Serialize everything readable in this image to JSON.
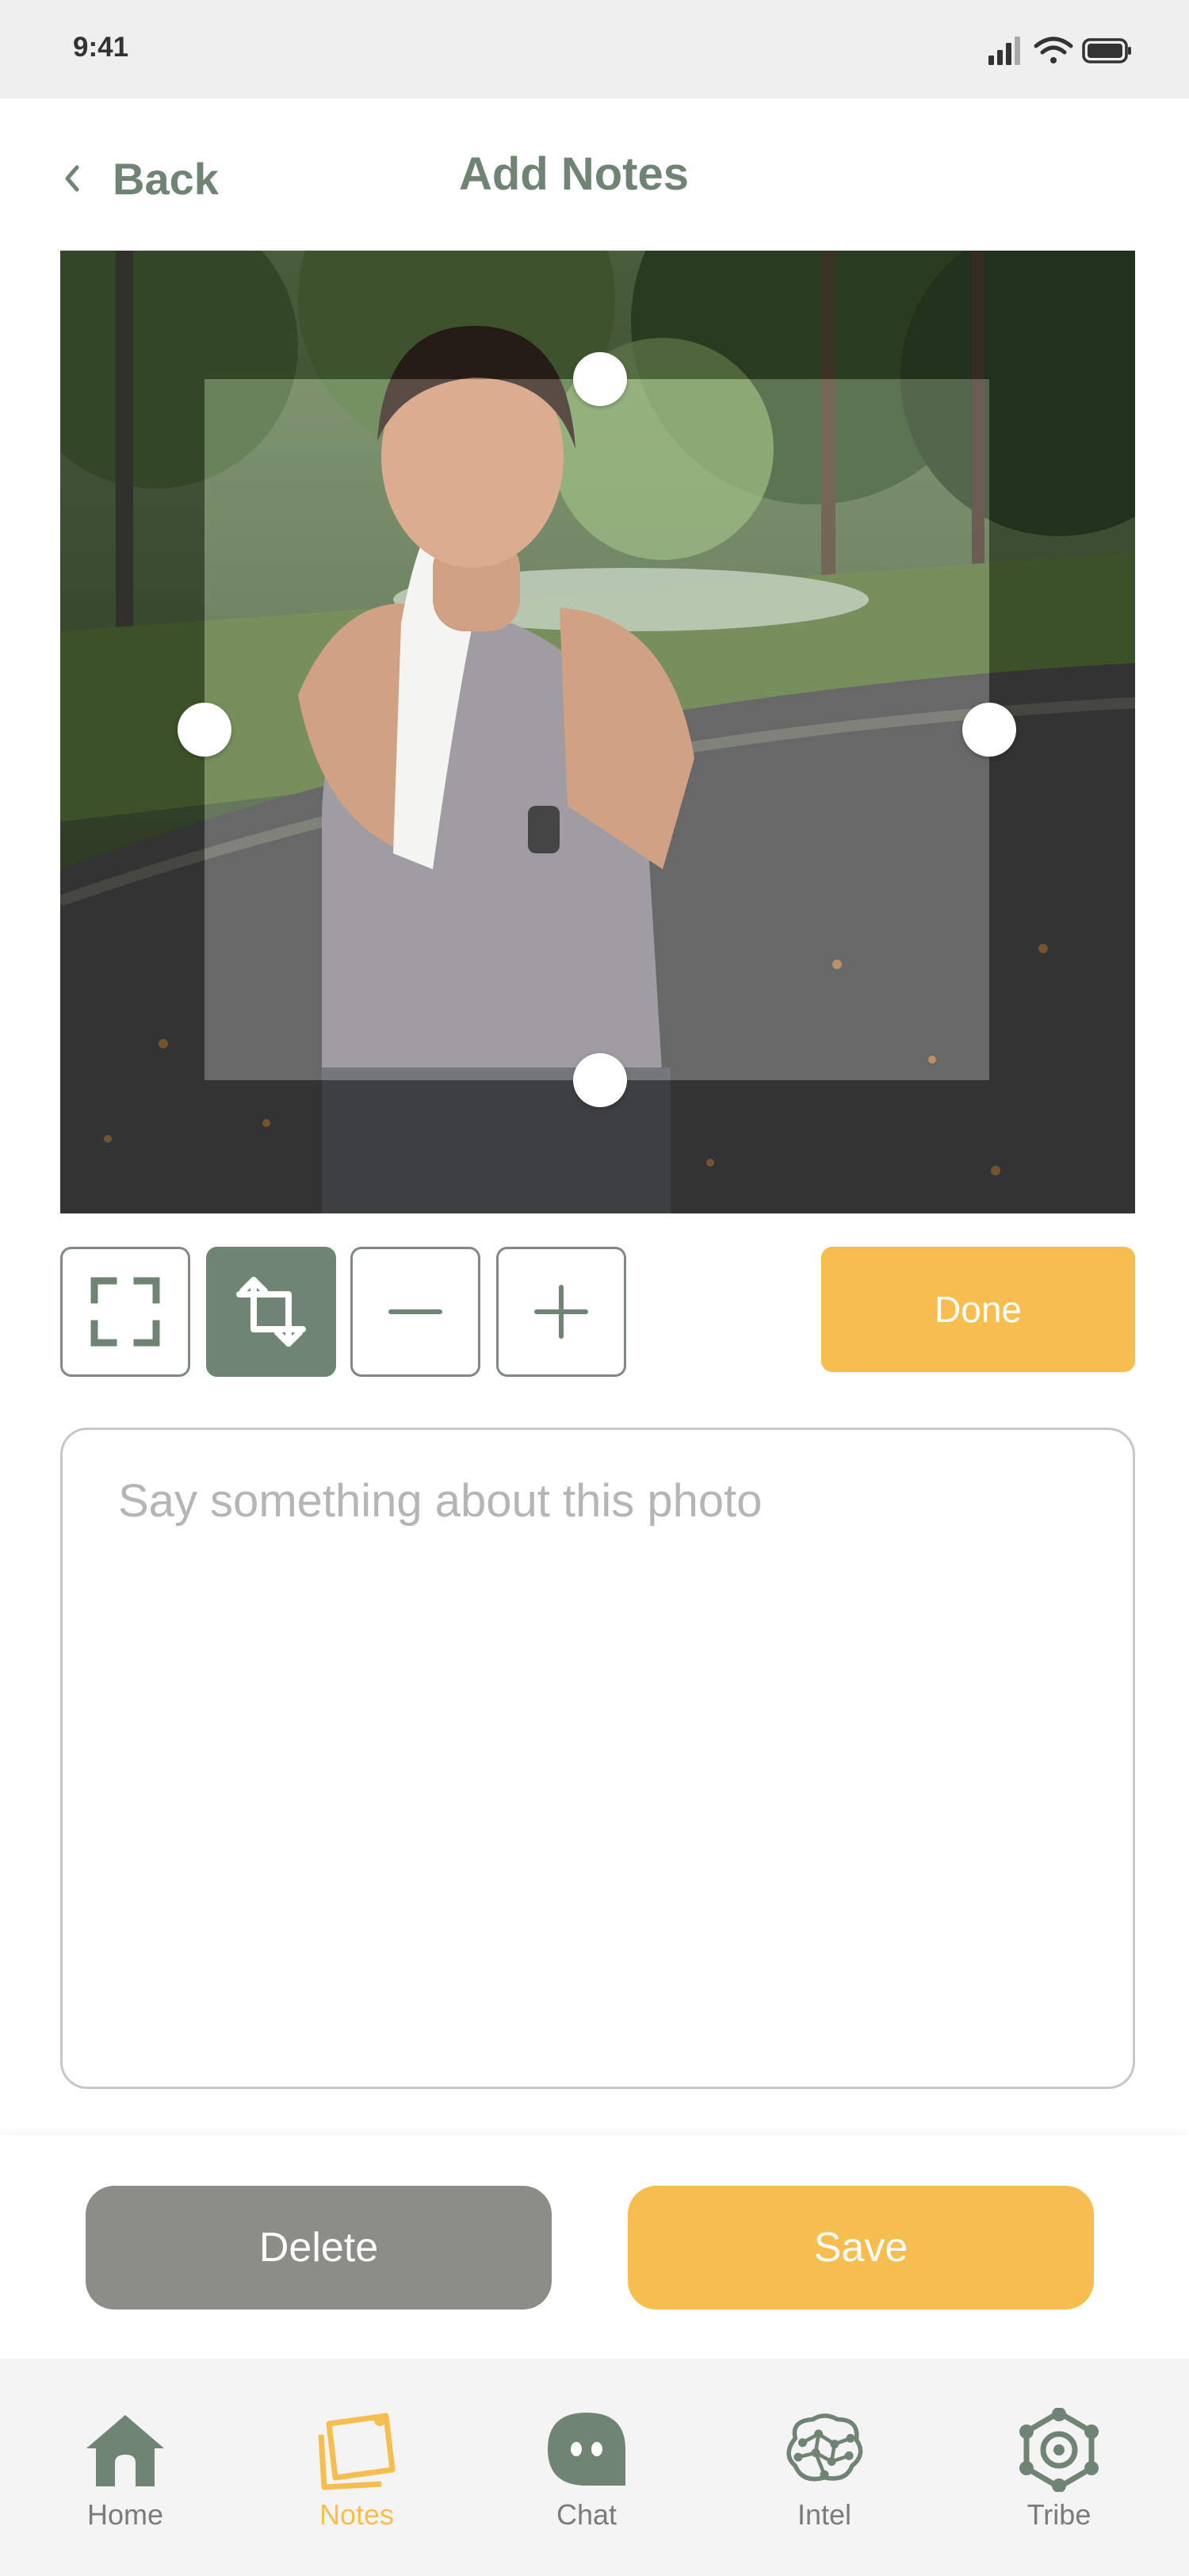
{
  "status_bar": {
    "time": "9:41"
  },
  "header": {
    "back_label": "Back",
    "title": "Add Notes"
  },
  "editor": {
    "tools": [
      {
        "name": "fullscreen",
        "icon": "fullscreen-icon",
        "active": false
      },
      {
        "name": "crop",
        "icon": "crop-icon",
        "active": true
      },
      {
        "name": "zoom-out",
        "icon": "minus-icon",
        "active": false
      },
      {
        "name": "zoom-in",
        "icon": "plus-icon",
        "active": false
      }
    ],
    "done_label": "Done"
  },
  "notes": {
    "placeholder": "Say something about this photo",
    "value": ""
  },
  "actions": {
    "delete_label": "Delete",
    "save_label": "Save"
  },
  "tab_bar": {
    "items": [
      {
        "label": "Home",
        "icon": "home-icon"
      },
      {
        "label": "Notes",
        "icon": "notes-icon",
        "active": true
      },
      {
        "label": "Chat",
        "icon": "chat-icon"
      },
      {
        "label": "Intel",
        "icon": "brain-icon"
      },
      {
        "label": "Tribe",
        "icon": "tribe-icon"
      }
    ]
  },
  "colors": {
    "accent": "#f5be4e",
    "primary": "#6f8472",
    "neutral_button": "#8c8d87"
  }
}
